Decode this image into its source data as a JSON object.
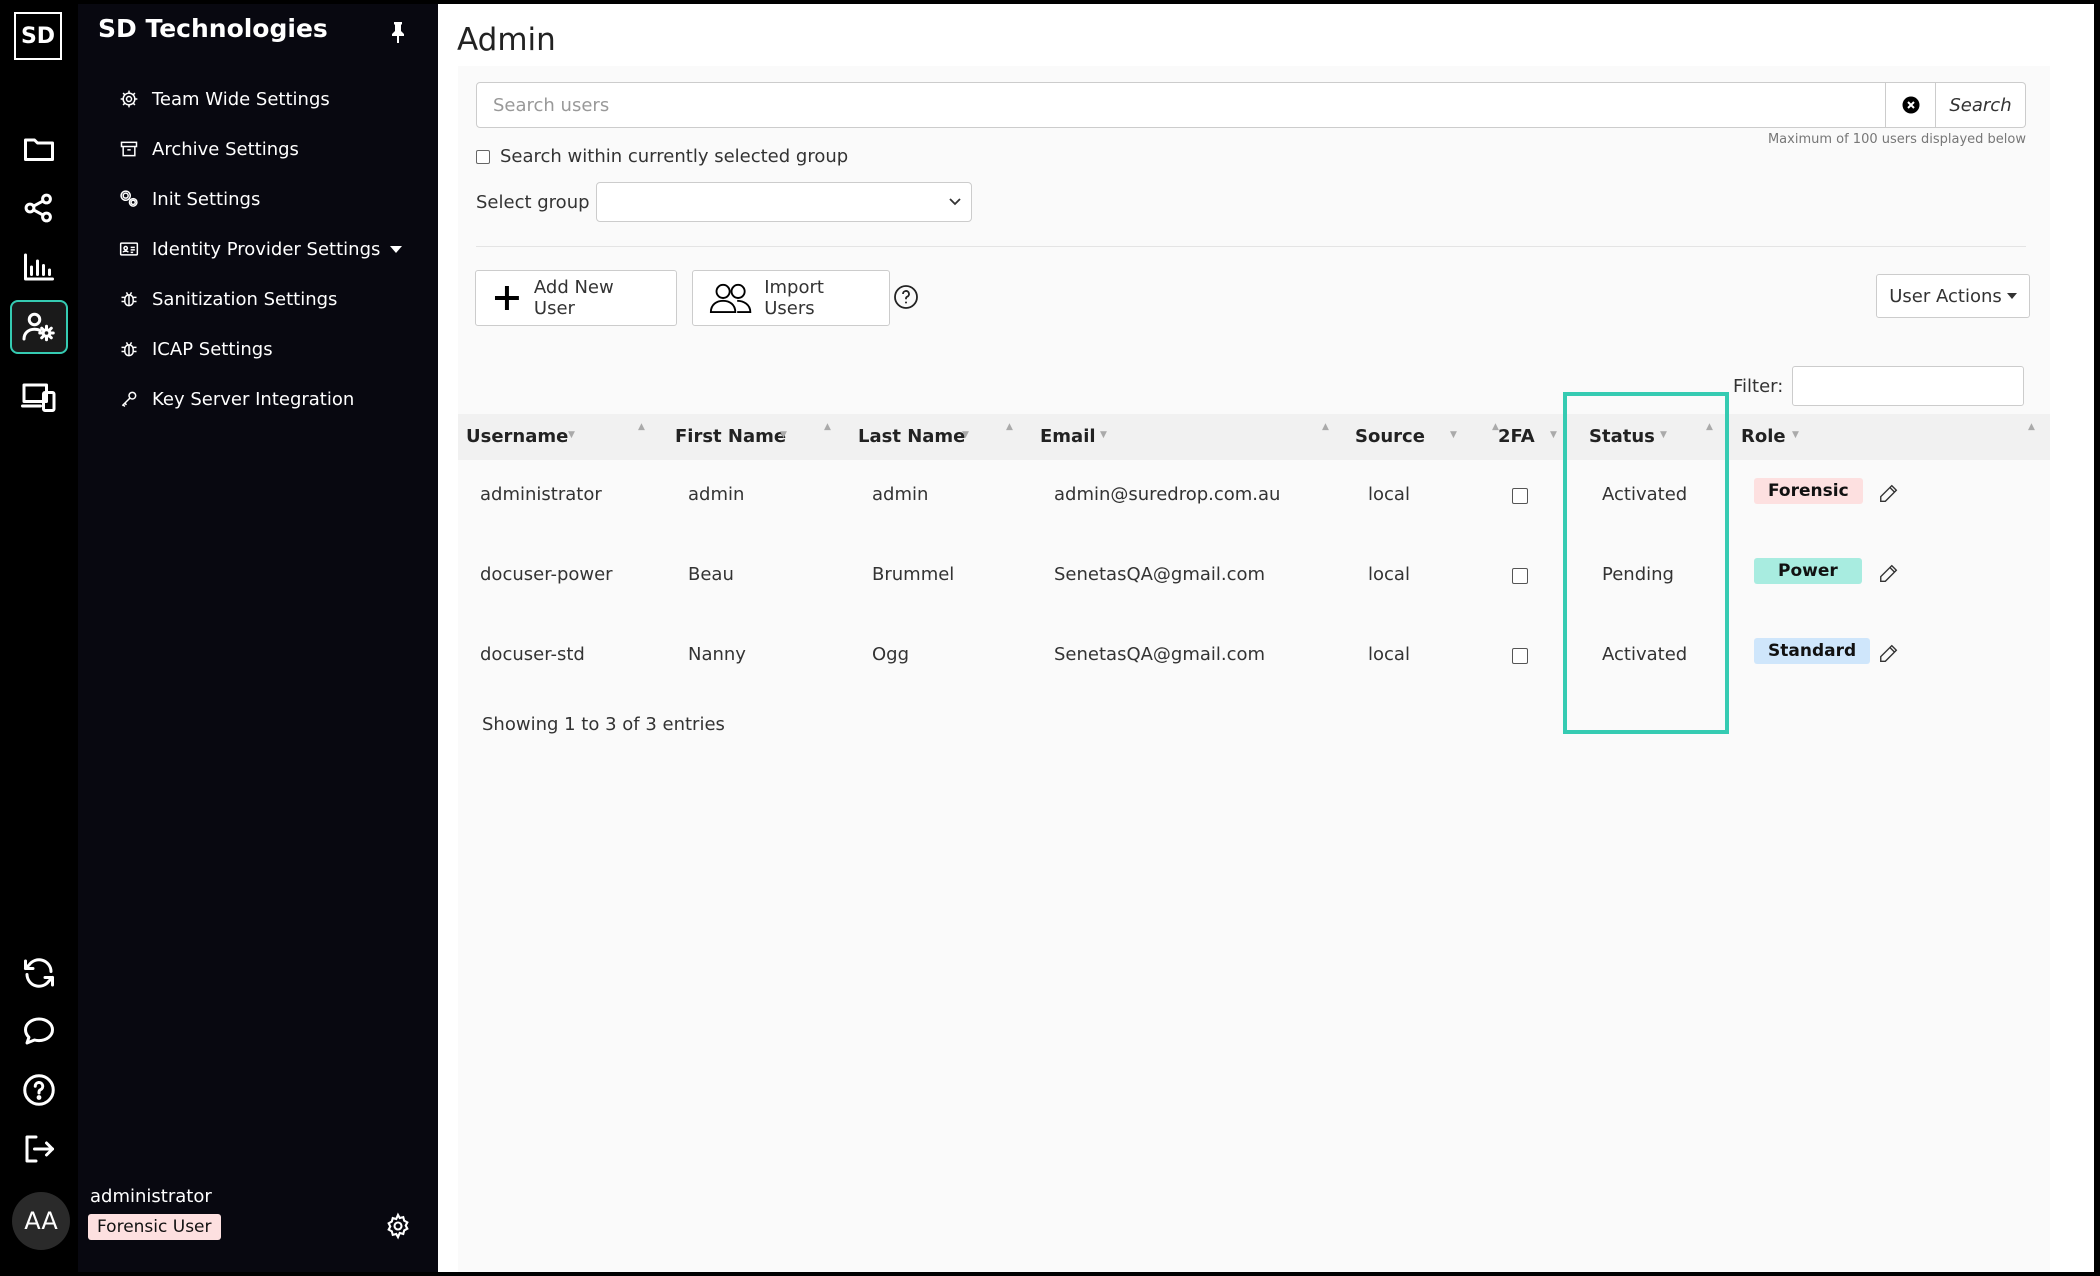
{
  "brand": {
    "logo": "SD",
    "company": "SD Technologies"
  },
  "rail": {
    "icons": [
      "folder-icon",
      "share-icon",
      "chart-icon",
      "user-settings-icon",
      "devices-icon",
      "sync-icon",
      "chat-icon",
      "help-icon",
      "logout-icon"
    ],
    "avatar": "AA"
  },
  "sidebar": {
    "items": [
      {
        "label": "Team Wide Settings",
        "icon": "gear-icon"
      },
      {
        "label": "Archive Settings",
        "icon": "archive-icon"
      },
      {
        "label": "Init Settings",
        "icon": "gears-icon"
      },
      {
        "label": "Identity Provider Settings",
        "icon": "id-card-icon"
      },
      {
        "label": "Sanitization Settings",
        "icon": "bug-icon"
      },
      {
        "label": "ICAP Settings",
        "icon": "bug-icon"
      },
      {
        "label": "Key Server Integration",
        "icon": "key-icon"
      }
    ],
    "user": {
      "name": "administrator",
      "role": "Forensic User"
    }
  },
  "page": {
    "title": "Admin"
  },
  "search": {
    "placeholder": "Search users",
    "button": "Search",
    "max_note": "Maximum of 100 users displayed below",
    "within_group_label": "Search within currently selected group",
    "select_group_label": "Select group"
  },
  "actions": {
    "add_user": "Add New User",
    "import_users": "Import Users",
    "user_actions": "User Actions"
  },
  "filter_label": "Filter:",
  "table": {
    "columns": [
      "Username",
      "First Name",
      "Last Name",
      "Email",
      "Source",
      "2FA",
      "Status",
      "Role"
    ],
    "rows": [
      {
        "username": "administrator",
        "first": "admin",
        "last": "admin",
        "email": "admin@suredrop.com.au",
        "source": "local",
        "twofa": false,
        "status": "Activated",
        "role": "Forensic"
      },
      {
        "username": "docuser-power",
        "first": "Beau",
        "last": "Brummel",
        "email": "SenetasQA@gmail.com",
        "source": "local",
        "twofa": false,
        "status": "Pending",
        "role": "Power"
      },
      {
        "username": "docuser-std",
        "first": "Nanny",
        "last": "Ogg",
        "email": "SenetasQA@gmail.com",
        "source": "local",
        "twofa": false,
        "status": "Activated",
        "role": "Standard"
      }
    ],
    "footer": "Showing 1 to 3 of 3 entries"
  },
  "colors": {
    "accent": "#35cbb2",
    "forensic": "#fde0e0",
    "power": "#a8ece0",
    "standard": "#cfe6fb",
    "sidebar_bg": "#080810"
  }
}
